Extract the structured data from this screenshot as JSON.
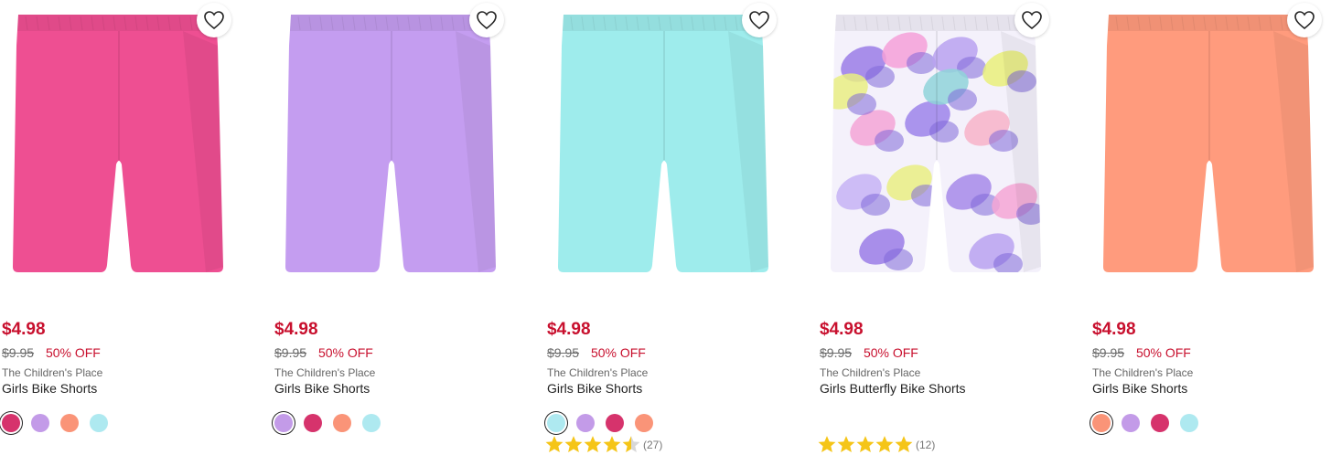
{
  "products": [
    {
      "price": "$4.98",
      "original_price": "$9.95",
      "discount": "50% OFF",
      "brand": "The Children's Place",
      "title": "Girls Bike Shorts",
      "image_color": "#ee4f92",
      "image_pattern": "solid",
      "favorite_icon": "heart-outline-icon",
      "swatches": [
        {
          "color": "#d6336c",
          "selected": true
        },
        {
          "color": "#c39be8",
          "selected": false
        },
        {
          "color": "#fa9478",
          "selected": false
        },
        {
          "color": "#aee9f0",
          "selected": false
        }
      ],
      "rating": null
    },
    {
      "price": "$4.98",
      "original_price": "$9.95",
      "discount": "50% OFF",
      "brand": "The Children's Place",
      "title": "Girls Bike Shorts",
      "image_color": "#c49df0",
      "image_pattern": "solid",
      "favorite_icon": "heart-outline-icon",
      "swatches": [
        {
          "color": "#c39be8",
          "selected": true
        },
        {
          "color": "#d6336c",
          "selected": false
        },
        {
          "color": "#fa9478",
          "selected": false
        },
        {
          "color": "#aee9f0",
          "selected": false
        }
      ],
      "rating": null
    },
    {
      "price": "$4.98",
      "original_price": "$9.95",
      "discount": "50% OFF",
      "brand": "The Children's Place",
      "title": "Girls Bike Shorts",
      "image_color": "#9eecec",
      "image_pattern": "solid",
      "favorite_icon": "heart-outline-icon",
      "swatches": [
        {
          "color": "#aee9f0",
          "selected": true
        },
        {
          "color": "#c39be8",
          "selected": false
        },
        {
          "color": "#d6336c",
          "selected": false
        },
        {
          "color": "#fa9478",
          "selected": false
        }
      ],
      "rating": {
        "stars": 4.5,
        "count": "(27)"
      }
    },
    {
      "price": "$4.98",
      "original_price": "$9.95",
      "discount": "50% OFF",
      "brand": "The Children's Place",
      "title": "Girls Butterfly Bike Shorts",
      "image_color": "#f4f1fb",
      "image_pattern": "butterfly",
      "favorite_icon": "heart-outline-icon",
      "swatches": [],
      "rating": {
        "stars": 5,
        "count": "(12)"
      }
    },
    {
      "price": "$4.98",
      "original_price": "$9.95",
      "discount": "50% OFF",
      "brand": "The Children's Place",
      "title": "Girls Bike Shorts",
      "image_color": "#ff9b7d",
      "image_pattern": "solid",
      "favorite_icon": "heart-outline-icon",
      "swatches": [
        {
          "color": "#fa9478",
          "selected": true
        },
        {
          "color": "#c39be8",
          "selected": false
        },
        {
          "color": "#d6336c",
          "selected": false
        },
        {
          "color": "#aee9f0",
          "selected": false
        }
      ],
      "rating": null
    }
  ],
  "colors": {
    "sale_price": "#c8102e",
    "star_fill": "#f5c518",
    "star_empty": "#d8d8d8"
  }
}
